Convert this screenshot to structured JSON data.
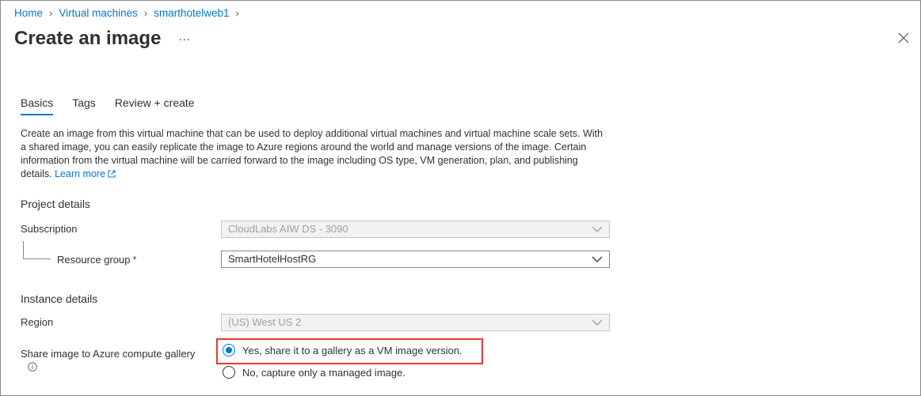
{
  "breadcrumb": [
    {
      "label": "Home"
    },
    {
      "label": "Virtual machines"
    },
    {
      "label": "smarthotelweb1"
    }
  ],
  "page": {
    "title": "Create an image",
    "more_label": "...",
    "close_icon": "close-icon"
  },
  "tabs": [
    {
      "label": "Basics",
      "active": true
    },
    {
      "label": "Tags",
      "active": false
    },
    {
      "label": "Review + create",
      "active": false
    }
  ],
  "description": {
    "text": "Create an image from this virtual machine that can be used to deploy additional virtual machines and virtual machine scale sets. With a shared image, you can easily replicate the image to Azure regions around the world and manage versions of the image. Certain information from the virtual machine will be carried forward to the image including OS type, VM generation, plan, and publishing details.",
    "link_label": "Learn more"
  },
  "project_details": {
    "heading": "Project details",
    "subscription_label": "Subscription",
    "subscription_value": "CloudLabs AIW DS - 3090",
    "resource_group_label": "Resource group",
    "resource_group_required": "*",
    "resource_group_value": "SmartHotelHostRG"
  },
  "instance_details": {
    "heading": "Instance details",
    "region_label": "Region",
    "region_value": "(US) West US 2",
    "share_label": "Share image to Azure compute gallery",
    "share_options": [
      {
        "label": "Yes, share it to a gallery as a VM image version.",
        "selected": true
      },
      {
        "label": "No, capture only a managed image.",
        "selected": false
      }
    ]
  },
  "colors": {
    "accent": "#0078d4",
    "highlight": "#e8382f",
    "required": "#a4262c"
  }
}
